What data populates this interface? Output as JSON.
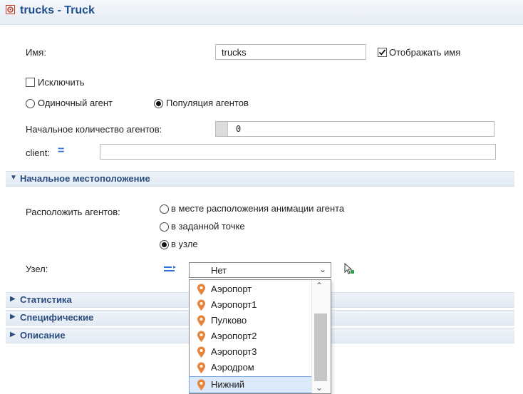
{
  "header": {
    "title": "trucks - Truck",
    "icon": "agent-population-icon"
  },
  "name_field": {
    "label": "Имя:",
    "value": "trucks",
    "show_name_label": "Отображать имя",
    "show_name_checked": true
  },
  "exclude": {
    "label": "Исключить",
    "checked": false
  },
  "agent_mode": {
    "single_label": "Одиночный агент",
    "population_label": "Популяция агентов",
    "selected": "population"
  },
  "initial_count": {
    "label": "Начальное количество агентов:",
    "value": "0"
  },
  "client": {
    "label": "client:",
    "value": ""
  },
  "location_section": {
    "title": "Начальное местоположение",
    "place_label": "Расположить агентов:",
    "options": [
      "в месте расположения анимации агента",
      "в заданной точке",
      "в узле"
    ],
    "selected_index": 2
  },
  "node": {
    "label": "Узел:",
    "selected": "Нет",
    "options": [
      "Аэропорт",
      "Аэропорт1",
      "Пулково",
      "Аэропорт2",
      "Аэропорт3",
      "Аэродром",
      "Нижний"
    ],
    "highlighted": "Нижний"
  },
  "sections": [
    {
      "title": "Статистика"
    },
    {
      "title": "Специфические"
    },
    {
      "title": "Описание"
    }
  ],
  "colors": {
    "accent": "#1f4e8c",
    "pin": "#e8843a"
  }
}
